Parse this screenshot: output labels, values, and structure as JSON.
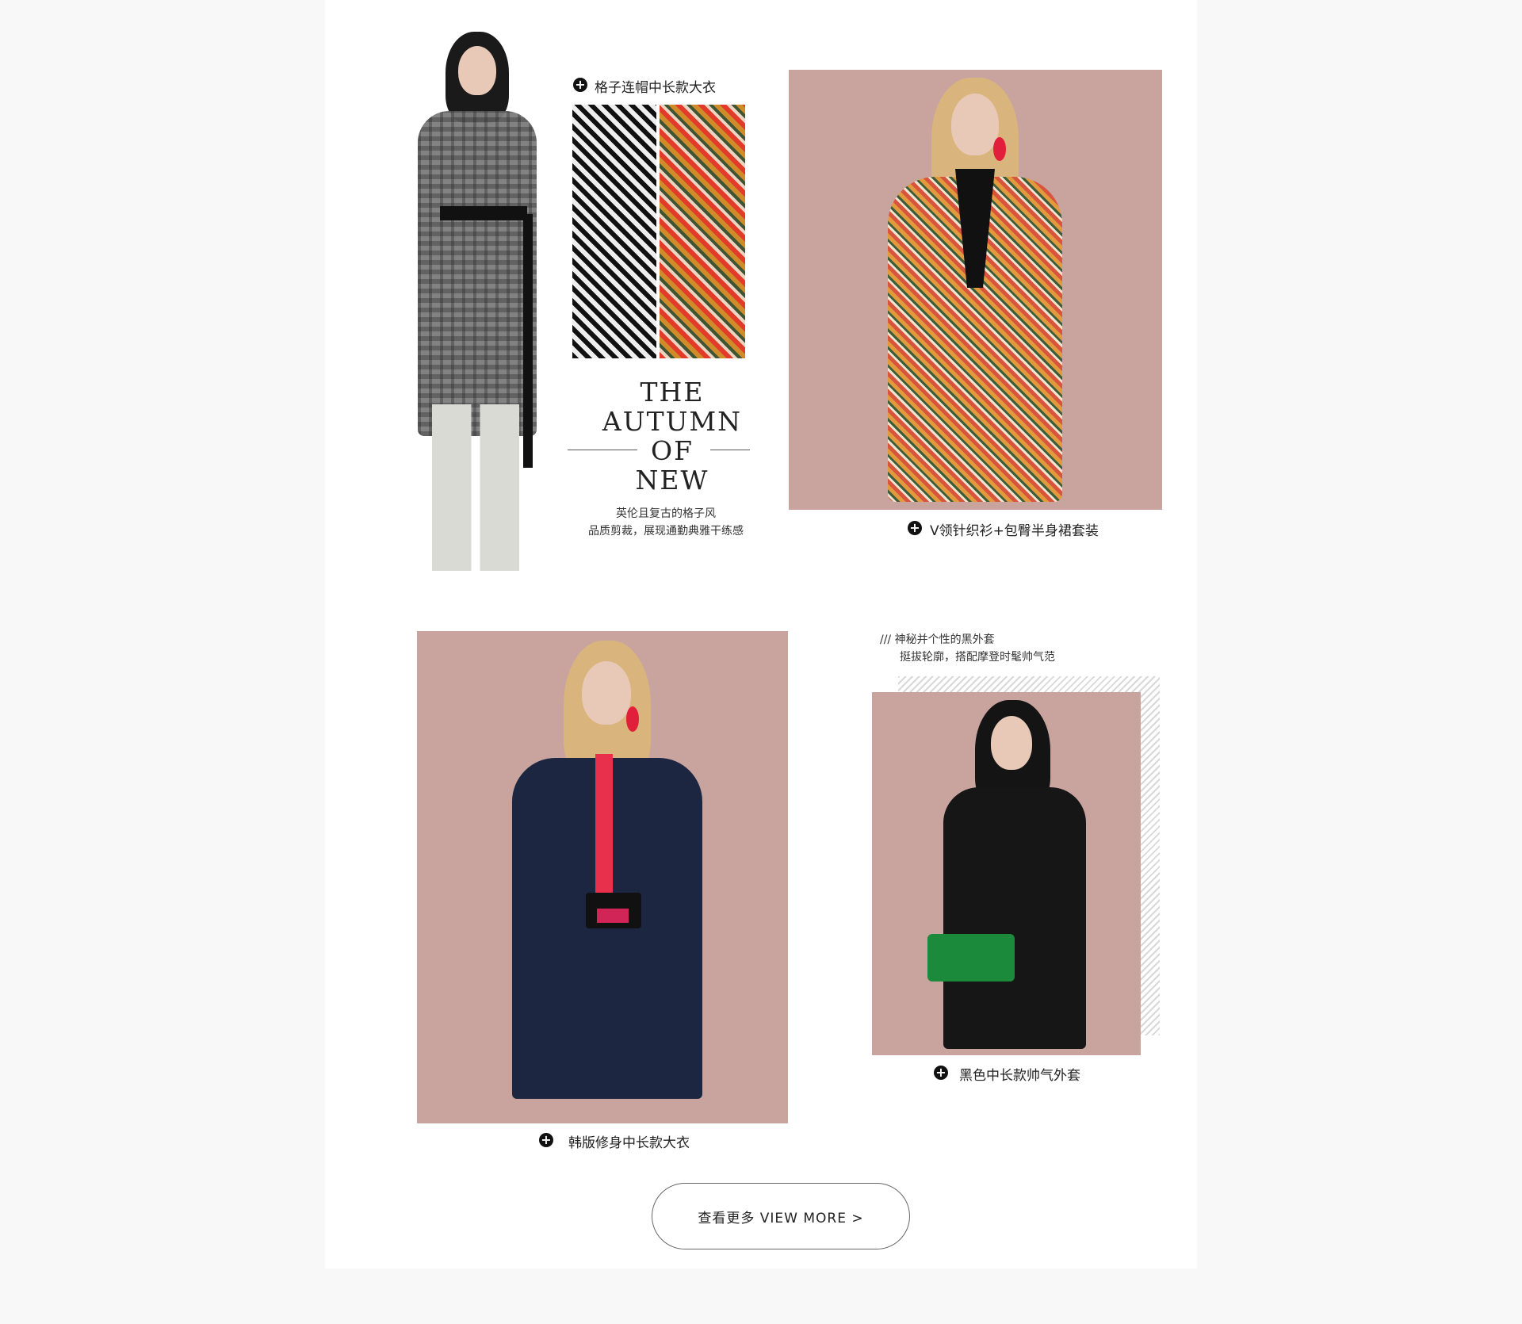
{
  "section1": {
    "coat_title": "格子连帽中长款大衣",
    "headline": [
      "THE",
      "AUTUMN",
      "OF",
      "NEW"
    ],
    "desc_line1": "英伦且复古的格子风",
    "desc_line2": "品质剪裁，展现通勤典雅干练感",
    "set_title": "V领针织衫+包臀半身裙套装"
  },
  "section2": {
    "coat_title": "韩版修身中长款大衣",
    "note_line1": "/// 神秘并个性的黑外套",
    "note_line2": "挺拔轮廓，搭配摩登时髦帅气范",
    "jacket_title": "黑色中长款帅气外套"
  },
  "button": {
    "label": "查看更多 VIEW MORE  >"
  },
  "colors": {
    "photo_bg": "#c9a49f",
    "page_bg": "#f8f8f9"
  },
  "icons": {
    "plus": "+"
  }
}
